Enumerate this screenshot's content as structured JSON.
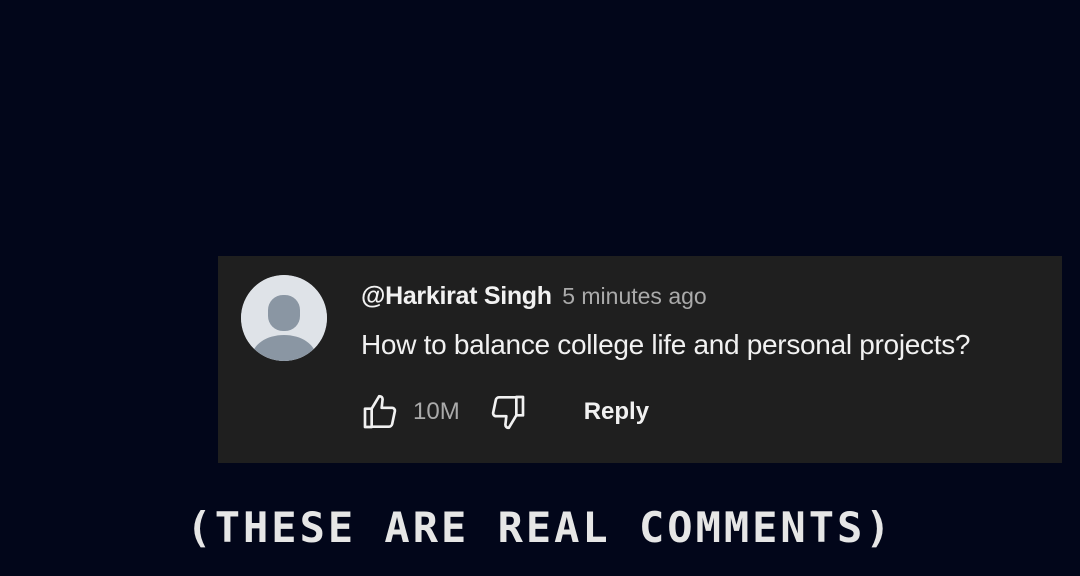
{
  "comment": {
    "author": "@Harkirat Singh",
    "timestamp": "5 minutes ago",
    "text": "How to balance college life and personal projects?",
    "like_count": "10M",
    "reply_label": "Reply",
    "avatar_icon": "default-user-avatar-icon",
    "like_icon": "thumbs-up-icon",
    "dislike_icon": "thumbs-down-icon"
  },
  "caption": {
    "text": "(THESE ARE REAL COMMENTS)"
  },
  "colors": {
    "background": "#02061a",
    "card": "#1f1f1f",
    "primary_text": "#f1f1f1",
    "secondary_text": "#aaaaaa",
    "caption_text": "#e6e6e6"
  }
}
